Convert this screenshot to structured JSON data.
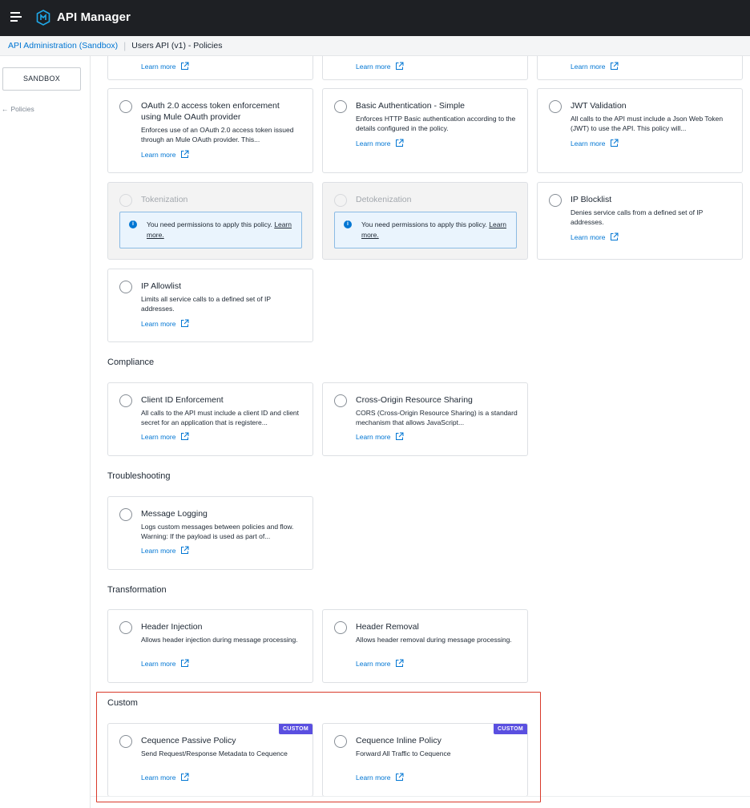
{
  "app": {
    "title": "API Manager"
  },
  "breadcrumb": {
    "root": "API Administration (Sandbox)",
    "current": "Users API (v1) - Policies"
  },
  "sidebar": {
    "environment": "SANDBOX",
    "back_label": "Policies"
  },
  "common": {
    "learn_more": "Learn more"
  },
  "top_partial_cards": [
    {
      "learn": "Learn more"
    },
    {
      "learn": "Learn more"
    },
    {
      "learn": "Learn more"
    }
  ],
  "security_cards": [
    {
      "title": "OAuth 2.0 access token enforcement using Mule OAuth provider",
      "description": "Enforces use of an OAuth 2.0 access token issued through an Mule OAuth provider. This...",
      "learn": "Learn more"
    },
    {
      "title": "Basic Authentication - Simple",
      "description": "Enforces HTTP Basic authentication according to the details configured in the policy.",
      "learn": "Learn more"
    },
    {
      "title": "JWT Validation",
      "description": "All calls to the API must include a Json Web Token (JWT) to use the API. This policy will...",
      "learn": "Learn more"
    },
    {
      "title": "Tokenization",
      "permission_text": "You need permissions to apply this policy.",
      "permission_link": "Learn more."
    },
    {
      "title": "Detokenization",
      "permission_text": "You need permissions to apply this policy.",
      "permission_link": "Learn more."
    },
    {
      "title": "IP Blocklist",
      "description": "Denies service calls from a defined set of IP addresses.",
      "learn": "Learn more"
    },
    {
      "title": "IP Allowlist",
      "description": "Limits all service calls to a defined set of IP addresses.",
      "learn": "Learn more"
    }
  ],
  "sections": {
    "compliance": {
      "title": "Compliance",
      "cards": [
        {
          "title": "Client ID Enforcement",
          "description": "All calls to the API must include a client ID and client secret for an application that is registere...",
          "learn": "Learn more"
        },
        {
          "title": "Cross-Origin Resource Sharing",
          "description": "CORS (Cross-Origin Resource Sharing) is a standard mechanism that allows JavaScript...",
          "learn": "Learn more"
        }
      ]
    },
    "troubleshooting": {
      "title": "Troubleshooting",
      "cards": [
        {
          "title": "Message Logging",
          "description": "Logs custom messages between policies and flow. Warning: If the payload is used as part of...",
          "learn": "Learn more"
        }
      ]
    },
    "transformation": {
      "title": "Transformation",
      "cards": [
        {
          "title": "Header Injection",
          "description": "Allows header injection during message processing.",
          "learn": "Learn more"
        },
        {
          "title": "Header Removal",
          "description": "Allows header removal during message processing.",
          "learn": "Learn more"
        }
      ]
    },
    "custom": {
      "title": "Custom",
      "cards": [
        {
          "title": "Cequence Passive Policy",
          "description": "Send Request/Response Metadata to Cequence",
          "learn": "Learn more",
          "badge": "CUSTOM"
        },
        {
          "title": "Cequence Inline Policy",
          "description": "Forward All Traffic to Cequence",
          "learn": "Learn more",
          "badge": "CUSTOM"
        }
      ]
    }
  },
  "colors": {
    "topbar": "#1e2024",
    "link": "#0176d3",
    "badge": "#5a4fe0",
    "highlight": "#d93a2b",
    "info_bg": "#eaf4fd"
  }
}
